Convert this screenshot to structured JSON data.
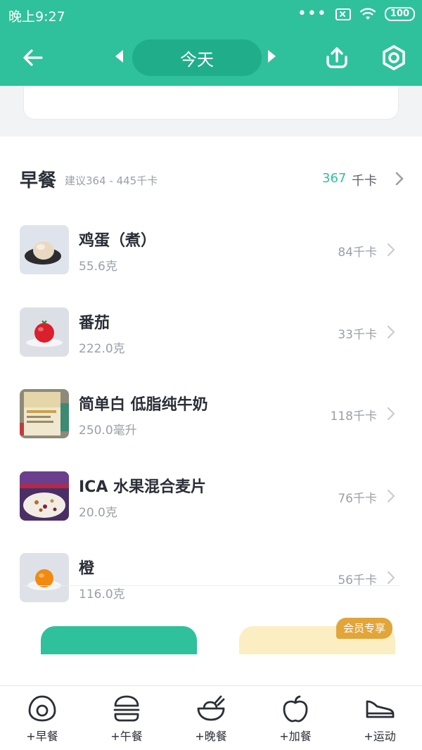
{
  "status_bar": {
    "time": "晚上9:27",
    "battery": "100"
  },
  "toolbar": {
    "date_label": "今天"
  },
  "meal": {
    "title": "早餐",
    "suggestion": "建议364 - 445千卡",
    "total_kcal": "367",
    "kcal_unit": "千卡"
  },
  "foods": [
    {
      "name": "鸡蛋（煮）",
      "quantity": "55.6克",
      "kcal": "84千卡",
      "icon": "boiled-egg"
    },
    {
      "name": "番茄",
      "quantity": "222.0克",
      "kcal": "33千卡",
      "icon": "tomato"
    },
    {
      "name": "简单白 低脂纯牛奶",
      "quantity": "250.0毫升",
      "kcal": "118千卡",
      "icon": "milk-carton"
    },
    {
      "name": "ICA 水果混合麦片",
      "quantity": "20.0克",
      "kcal": "76千卡",
      "icon": "cereal-box"
    },
    {
      "name": "橙",
      "quantity": "116.0克",
      "kcal": "56千卡",
      "icon": "orange"
    }
  ],
  "promo": {
    "vip_label": "会员专享"
  },
  "bottom_nav": [
    {
      "label": "+早餐",
      "icon": "egg-icon"
    },
    {
      "label": "+午餐",
      "icon": "burger-icon"
    },
    {
      "label": "+晚餐",
      "icon": "bowl-icon"
    },
    {
      "label": "+加餐",
      "icon": "apple-icon"
    },
    {
      "label": "+运动",
      "icon": "shoe-icon"
    }
  ],
  "colors": {
    "primary": "#2fc19b",
    "primary_dark": "#1fae89",
    "text_dark": "#2a2e37",
    "text_muted": "#9aa0a8",
    "vip": "#e2a53a"
  }
}
